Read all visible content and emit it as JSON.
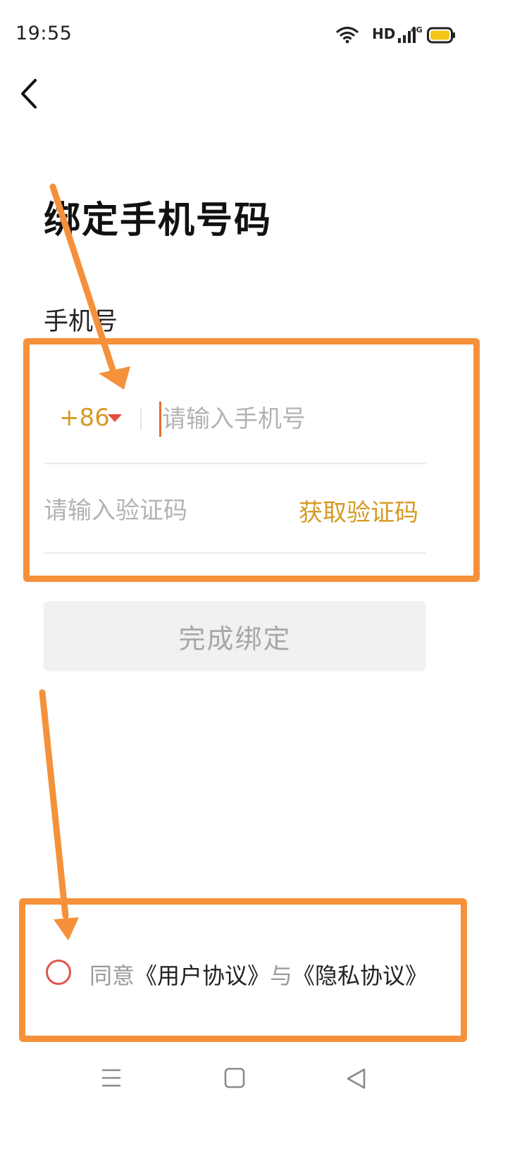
{
  "status_bar": {
    "time": "19:55",
    "hd_label": "HD",
    "network_label": "4G",
    "icons": [
      "wifi-icon",
      "signal-icon",
      "battery-icon"
    ],
    "battery_color": "#f5c518"
  },
  "header": {
    "back_icon": "chevron-left-icon"
  },
  "page": {
    "title": "绑定手机号码"
  },
  "form": {
    "phone_label": "手机号",
    "country_code": "+86",
    "phone_placeholder": "请输入手机号",
    "phone_value": "",
    "code_placeholder": "请输入验证码",
    "code_value": "",
    "get_code_label": "获取验证码",
    "submit_label": "完成绑定"
  },
  "agreement": {
    "agree_prefix": "同意",
    "user_agreement": "《用户协议》",
    "conjunction": "与",
    "privacy_policy": "《隐私协议》",
    "checked": false
  },
  "bottom_nav": {
    "icons": [
      "menu-icon",
      "home-square-icon",
      "back-triangle-icon"
    ]
  },
  "colors": {
    "accent": "#d69a22",
    "annotation": "#f5913a",
    "radio": "#e0554b",
    "caret": "#e64a3c"
  }
}
